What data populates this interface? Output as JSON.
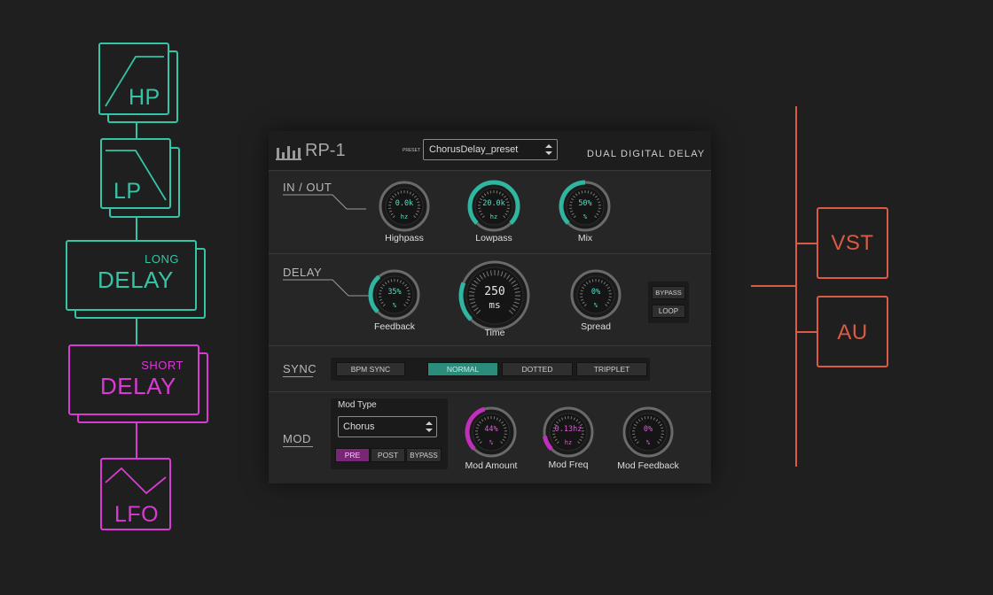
{
  "flow": {
    "hp_label": "HP",
    "lp_label": "LP",
    "long_delay": {
      "small": "LONG",
      "big": "DELAY"
    },
    "short_delay": {
      "small": "SHORT",
      "big": "DELAY"
    },
    "lfo_label": "LFO"
  },
  "formats": {
    "vst": "VST",
    "au": "AU"
  },
  "plugin": {
    "name": "RP-1",
    "preset_small": "PRESET",
    "preset_value": "ChorusDelay_preset",
    "subtitle": "DUAL DIGITAL DELAY",
    "in_out": {
      "label": "IN / OUT",
      "knobs": [
        {
          "value": "0.0k",
          "unit": "hz",
          "label": "Highpass"
        },
        {
          "value": "20.0k",
          "unit": "hz",
          "label": "Lowpass"
        },
        {
          "value": "50%",
          "unit": "%",
          "label": "Mix"
        }
      ]
    },
    "delay": {
      "label": "DELAY",
      "feedback": {
        "value": "35%",
        "unit": "%",
        "label": "Feedback"
      },
      "time": {
        "value": "250",
        "unit": "ms",
        "label": "Time"
      },
      "spread": {
        "value": "0%",
        "unit": "%",
        "label": "Spread"
      },
      "bypass": "BYPASS",
      "loop": "LOOP"
    },
    "sync": {
      "label": "SYNC",
      "bpm_sync": "BPM SYNC",
      "normal": "NORMAL",
      "dotted": "DOTTED",
      "tripplet": "TRIPPLET"
    },
    "mod": {
      "label": "MOD",
      "mod_type_label": "Mod Type",
      "mod_type_value": "Chorus",
      "pre": "PRE",
      "post": "POST",
      "bypass": "BYPASS",
      "amount": {
        "value": "44%",
        "unit": "%",
        "label": "Mod Amount"
      },
      "freq": {
        "value": "0.13hz",
        "unit": "hz",
        "label": "Mod Freq"
      },
      "feedback": {
        "value": "0%",
        "unit": "%",
        "label": "Mod Feedback"
      }
    }
  },
  "colors": {
    "teal": "#34c4a6",
    "magenta": "#d93ad3",
    "orange": "#d95b45",
    "knob_teal": "#2fb5a0",
    "knob_magenta": "#c02fbc"
  },
  "knob_levels": {
    "highpass": 0.0,
    "lowpass": 1.0,
    "mix": 0.5,
    "feedback": 0.35,
    "time": 0.25,
    "spread": 0.0,
    "mod_amount": 0.44,
    "mod_freq": 0.13,
    "mod_feedback": 0.0
  }
}
